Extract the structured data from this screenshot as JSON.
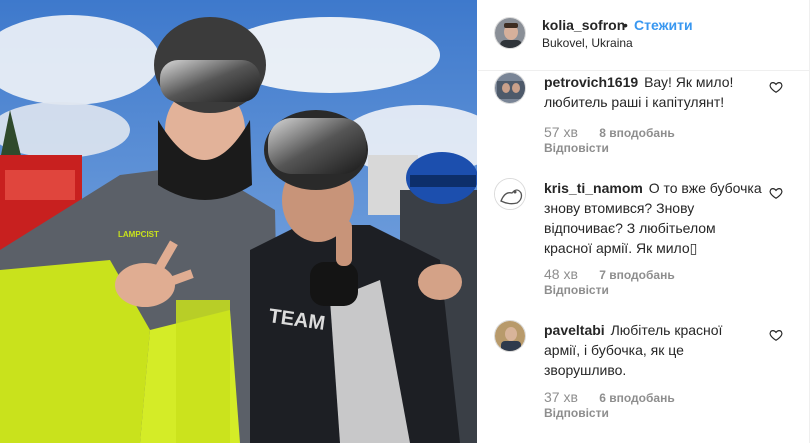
{
  "post": {
    "username": "kolia_sofron",
    "separator": "•",
    "follow_label": "Стежити",
    "location": "Bukovel, Ukraina"
  },
  "comments": [
    {
      "username": "petrovich1619",
      "text": "Вау! Як мило! любитель раші і капітулянт!",
      "time": "57 хв",
      "likes": "8 вподобань",
      "reply_label": "Відповісти"
    },
    {
      "username": "kris_ti_namom",
      "text": "О то вже бубочка знову втомився? Знову відпочиває? З любітьелом красної армії. Як мило▯",
      "time": "48 хв",
      "likes": "7 вподобань",
      "reply_label": "Відповісти"
    },
    {
      "username": "paveltabi",
      "text": "Любітель красної армії, і бубочка, як це зворушливо.",
      "time": "37 хв",
      "likes": "6 вподобань",
      "reply_label": "Відповісти"
    }
  ],
  "photo": {
    "jacket_brand": "LAMPCIST",
    "sleeve_text": "TEAM"
  },
  "colors": {
    "link_blue": "#3897f0",
    "text": "#262626",
    "muted": "#8e8e8e",
    "sky": "#4a86d4",
    "neon_yellow": "#c9e21c"
  }
}
